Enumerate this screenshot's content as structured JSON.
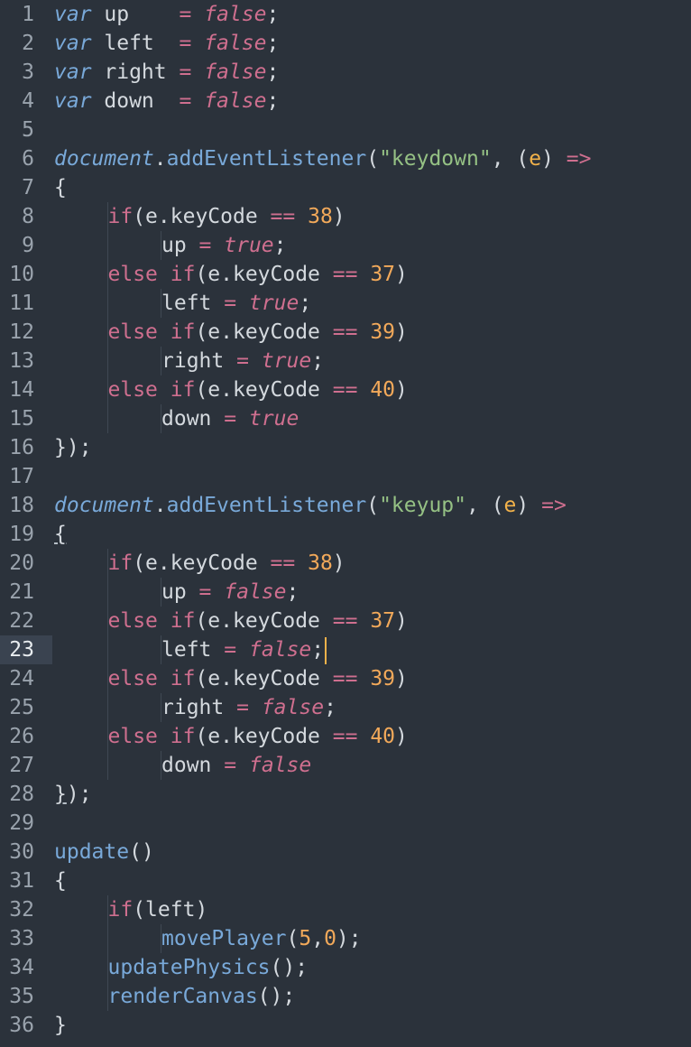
{
  "colors": {
    "background": "#2b323b",
    "text": "#d4d9de",
    "keyword": "#cf6f8f",
    "function": "#79a9d9",
    "string": "#95c184",
    "number": "#f2a95a",
    "param": "#f2b24a",
    "gutter": "#9aa3ad",
    "caret": "#f2b24a"
  },
  "editor": {
    "active_line": 23,
    "lines": [
      {
        "n": "1",
        "tokens": [
          {
            "t": "var",
            "c": "var"
          },
          {
            "t": " up    ",
            "c": "text"
          },
          {
            "t": "= ",
            "c": "op"
          },
          {
            "t": "false",
            "c": "bool"
          },
          {
            "t": ";",
            "c": "text"
          }
        ]
      },
      {
        "n": "2",
        "tokens": [
          {
            "t": "var",
            "c": "var"
          },
          {
            "t": " left  ",
            "c": "text"
          },
          {
            "t": "= ",
            "c": "op"
          },
          {
            "t": "false",
            "c": "bool"
          },
          {
            "t": ";",
            "c": "text"
          }
        ]
      },
      {
        "n": "3",
        "tokens": [
          {
            "t": "var",
            "c": "var"
          },
          {
            "t": " right ",
            "c": "text"
          },
          {
            "t": "= ",
            "c": "op"
          },
          {
            "t": "false",
            "c": "bool"
          },
          {
            "t": ";",
            "c": "text"
          }
        ]
      },
      {
        "n": "4",
        "tokens": [
          {
            "t": "var",
            "c": "var"
          },
          {
            "t": " down  ",
            "c": "text"
          },
          {
            "t": "= ",
            "c": "op"
          },
          {
            "t": "false",
            "c": "bool"
          },
          {
            "t": ";",
            "c": "text"
          }
        ]
      },
      {
        "n": "5",
        "tokens": []
      },
      {
        "n": "6",
        "tokens": [
          {
            "t": "document",
            "c": "doc"
          },
          {
            "t": ".",
            "c": "text"
          },
          {
            "t": "addEventListener",
            "c": "fn"
          },
          {
            "t": "(",
            "c": "text"
          },
          {
            "t": "\"keydown\"",
            "c": "str"
          },
          {
            "t": ", (",
            "c": "text"
          },
          {
            "t": "e",
            "c": "param"
          },
          {
            "t": ") ",
            "c": "text"
          },
          {
            "t": "=>",
            "c": "op"
          }
        ]
      },
      {
        "n": "7",
        "tokens": [
          {
            "t": "{",
            "c": "text"
          }
        ]
      },
      {
        "n": "8",
        "indent": 1,
        "tokens": [
          {
            "t": "if",
            "c": "kw"
          },
          {
            "t": "(e.keyCode ",
            "c": "text"
          },
          {
            "t": "==",
            "c": "op"
          },
          {
            "t": " ",
            "c": "text"
          },
          {
            "t": "38",
            "c": "num"
          },
          {
            "t": ")",
            "c": "text"
          }
        ]
      },
      {
        "n": "9",
        "indent": 2,
        "tokens": [
          {
            "t": "up ",
            "c": "text"
          },
          {
            "t": "=",
            "c": "op"
          },
          {
            "t": " ",
            "c": "text"
          },
          {
            "t": "true",
            "c": "bool"
          },
          {
            "t": ";",
            "c": "text"
          }
        ]
      },
      {
        "n": "10",
        "indent": 1,
        "tokens": [
          {
            "t": "else if",
            "c": "kw"
          },
          {
            "t": "(e.keyCode ",
            "c": "text"
          },
          {
            "t": "==",
            "c": "op"
          },
          {
            "t": " ",
            "c": "text"
          },
          {
            "t": "37",
            "c": "num"
          },
          {
            "t": ")",
            "c": "text"
          }
        ]
      },
      {
        "n": "11",
        "indent": 2,
        "tokens": [
          {
            "t": "left ",
            "c": "text"
          },
          {
            "t": "=",
            "c": "op"
          },
          {
            "t": " ",
            "c": "text"
          },
          {
            "t": "true",
            "c": "bool"
          },
          {
            "t": ";",
            "c": "text"
          }
        ]
      },
      {
        "n": "12",
        "indent": 1,
        "tokens": [
          {
            "t": "else if",
            "c": "kw"
          },
          {
            "t": "(e.keyCode ",
            "c": "text"
          },
          {
            "t": "==",
            "c": "op"
          },
          {
            "t": " ",
            "c": "text"
          },
          {
            "t": "39",
            "c": "num"
          },
          {
            "t": ")",
            "c": "text"
          }
        ]
      },
      {
        "n": "13",
        "indent": 2,
        "tokens": [
          {
            "t": "right ",
            "c": "text"
          },
          {
            "t": "=",
            "c": "op"
          },
          {
            "t": " ",
            "c": "text"
          },
          {
            "t": "true",
            "c": "bool"
          },
          {
            "t": ";",
            "c": "text"
          }
        ]
      },
      {
        "n": "14",
        "indent": 1,
        "tokens": [
          {
            "t": "else if",
            "c": "kw"
          },
          {
            "t": "(e.keyCode ",
            "c": "text"
          },
          {
            "t": "==",
            "c": "op"
          },
          {
            "t": " ",
            "c": "text"
          },
          {
            "t": "40",
            "c": "num"
          },
          {
            "t": ")",
            "c": "text"
          }
        ]
      },
      {
        "n": "15",
        "indent": 2,
        "tokens": [
          {
            "t": "down ",
            "c": "text"
          },
          {
            "t": "=",
            "c": "op"
          },
          {
            "t": " ",
            "c": "text"
          },
          {
            "t": "true",
            "c": "bool"
          }
        ]
      },
      {
        "n": "16",
        "tokens": [
          {
            "t": "});",
            "c": "text"
          }
        ]
      },
      {
        "n": "17",
        "tokens": []
      },
      {
        "n": "18",
        "tokens": [
          {
            "t": "document",
            "c": "doc"
          },
          {
            "t": ".",
            "c": "text"
          },
          {
            "t": "addEventListener",
            "c": "fn"
          },
          {
            "t": "(",
            "c": "text"
          },
          {
            "t": "\"keyup\"",
            "c": "str"
          },
          {
            "t": ", (",
            "c": "text"
          },
          {
            "t": "e",
            "c": "param"
          },
          {
            "t": ") ",
            "c": "text"
          },
          {
            "t": "=>",
            "c": "op"
          }
        ]
      },
      {
        "n": "19",
        "tokens": [
          {
            "t": "{",
            "c": "brace"
          }
        ]
      },
      {
        "n": "20",
        "indent": 1,
        "tokens": [
          {
            "t": "if",
            "c": "kw"
          },
          {
            "t": "(e.keyCode ",
            "c": "text"
          },
          {
            "t": "==",
            "c": "op"
          },
          {
            "t": " ",
            "c": "text"
          },
          {
            "t": "38",
            "c": "num"
          },
          {
            "t": ")",
            "c": "text"
          }
        ]
      },
      {
        "n": "21",
        "indent": 2,
        "tokens": [
          {
            "t": "up ",
            "c": "text"
          },
          {
            "t": "=",
            "c": "op"
          },
          {
            "t": " ",
            "c": "text"
          },
          {
            "t": "false",
            "c": "bool"
          },
          {
            "t": ";",
            "c": "text"
          }
        ]
      },
      {
        "n": "22",
        "indent": 1,
        "tokens": [
          {
            "t": "else if",
            "c": "kw"
          },
          {
            "t": "(e.keyCode ",
            "c": "text"
          },
          {
            "t": "==",
            "c": "op"
          },
          {
            "t": " ",
            "c": "text"
          },
          {
            "t": "37",
            "c": "num"
          },
          {
            "t": ")",
            "c": "text"
          }
        ]
      },
      {
        "n": "23",
        "indent": 2,
        "caret": true,
        "tokens": [
          {
            "t": "left ",
            "c": "text"
          },
          {
            "t": "=",
            "c": "op"
          },
          {
            "t": " ",
            "c": "text"
          },
          {
            "t": "false",
            "c": "bool"
          },
          {
            "t": ";",
            "c": "text"
          }
        ]
      },
      {
        "n": "24",
        "indent": 1,
        "tokens": [
          {
            "t": "else if",
            "c": "kw"
          },
          {
            "t": "(e.keyCode ",
            "c": "text"
          },
          {
            "t": "==",
            "c": "op"
          },
          {
            "t": " ",
            "c": "text"
          },
          {
            "t": "39",
            "c": "num"
          },
          {
            "t": ")",
            "c": "text"
          }
        ]
      },
      {
        "n": "25",
        "indent": 2,
        "tokens": [
          {
            "t": "right ",
            "c": "text"
          },
          {
            "t": "=",
            "c": "op"
          },
          {
            "t": " ",
            "c": "text"
          },
          {
            "t": "false",
            "c": "bool"
          },
          {
            "t": ";",
            "c": "text"
          }
        ]
      },
      {
        "n": "26",
        "indent": 1,
        "tokens": [
          {
            "t": "else if",
            "c": "kw"
          },
          {
            "t": "(e.keyCode ",
            "c": "text"
          },
          {
            "t": "==",
            "c": "op"
          },
          {
            "t": " ",
            "c": "text"
          },
          {
            "t": "40",
            "c": "num"
          },
          {
            "t": ")",
            "c": "text"
          }
        ]
      },
      {
        "n": "27",
        "indent": 2,
        "tokens": [
          {
            "t": "down ",
            "c": "text"
          },
          {
            "t": "=",
            "c": "op"
          },
          {
            "t": " ",
            "c": "text"
          },
          {
            "t": "false",
            "c": "bool"
          }
        ]
      },
      {
        "n": "28",
        "tokens": [
          {
            "t": "}",
            "c": "brace"
          },
          {
            "t": ");",
            "c": "text"
          }
        ]
      },
      {
        "n": "29",
        "tokens": []
      },
      {
        "n": "30",
        "tokens": [
          {
            "t": "update",
            "c": "fn"
          },
          {
            "t": "()",
            "c": "text"
          }
        ]
      },
      {
        "n": "31",
        "tokens": [
          {
            "t": "{",
            "c": "text"
          }
        ]
      },
      {
        "n": "32",
        "indent": 1,
        "tokens": [
          {
            "t": "if",
            "c": "kw"
          },
          {
            "t": "(left)",
            "c": "text"
          }
        ]
      },
      {
        "n": "33",
        "indent": 2,
        "tokens": [
          {
            "t": "movePlayer",
            "c": "fn"
          },
          {
            "t": "(",
            "c": "text"
          },
          {
            "t": "5",
            "c": "num"
          },
          {
            "t": ",",
            "c": "text"
          },
          {
            "t": "0",
            "c": "num"
          },
          {
            "t": ");",
            "c": "text"
          }
        ]
      },
      {
        "n": "34",
        "indent": 1,
        "tokens": [
          {
            "t": "updatePhysics",
            "c": "fn"
          },
          {
            "t": "();",
            "c": "text"
          }
        ]
      },
      {
        "n": "35",
        "indent": 1,
        "tokens": [
          {
            "t": "renderCanvas",
            "c": "fn"
          },
          {
            "t": "();",
            "c": "text"
          }
        ]
      },
      {
        "n": "36",
        "tokens": [
          {
            "t": "}",
            "c": "text"
          }
        ]
      }
    ]
  }
}
